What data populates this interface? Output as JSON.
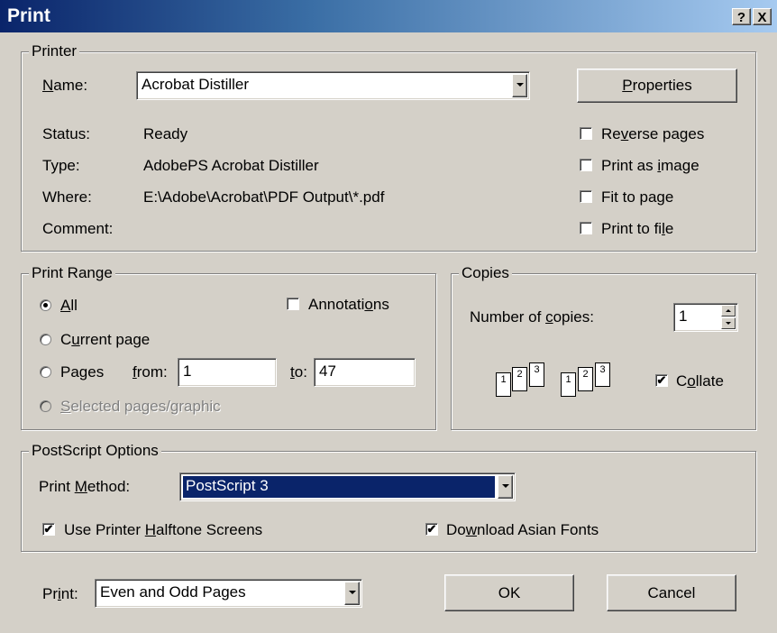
{
  "window": {
    "title": "Print",
    "help_btn": "?",
    "close_btn": "X"
  },
  "printer": {
    "legend": "Printer",
    "name_label": "Name:",
    "name_value": "Acrobat Distiller",
    "properties_btn": "Properties",
    "status_label": "Status:",
    "status_value": "Ready",
    "type_label": "Type:",
    "type_value": "AdobePS Acrobat Distiller",
    "where_label": "Where:",
    "where_value": "E:\\Adobe\\Acrobat\\PDF Output\\*.pdf",
    "comment_label": "Comment:",
    "options": [
      {
        "label": "Reverse pages",
        "checked": false
      },
      {
        "label": "Print as image",
        "checked": false
      },
      {
        "label": "Fit to page",
        "checked": false
      },
      {
        "label": "Print to file",
        "checked": false
      }
    ]
  },
  "print_range": {
    "legend": "Print Range",
    "all_label": "All",
    "current_label": "Current page",
    "pages_label": "Pages",
    "from_label": "from:",
    "from_value": "1",
    "to_label": "to:",
    "to_value": "47",
    "selected_label": "Selected pages/graphic",
    "annotations_label": "Annotations",
    "selected_option": "All"
  },
  "copies": {
    "legend": "Copies",
    "number_label": "Number of copies:",
    "number_value": "1",
    "collate_label": "Collate",
    "collate_checked": true,
    "page_nums": [
      "1",
      "2",
      "3"
    ]
  },
  "postscript": {
    "legend": "PostScript Options",
    "method_label": "Print Method:",
    "method_value": "PostScript 3",
    "halftone_label": "Use Printer Halftone Screens",
    "halftone_checked": true,
    "asian_fonts_label": "Download Asian Fonts",
    "asian_fonts_checked": true
  },
  "footer": {
    "print_label": "Print:",
    "print_value": "Even and Odd Pages",
    "ok_btn": "OK",
    "cancel_btn": "Cancel"
  },
  "colors": {
    "face": "#d4d0c8",
    "title_start": "#0a246a",
    "selection": "#0a246a"
  }
}
